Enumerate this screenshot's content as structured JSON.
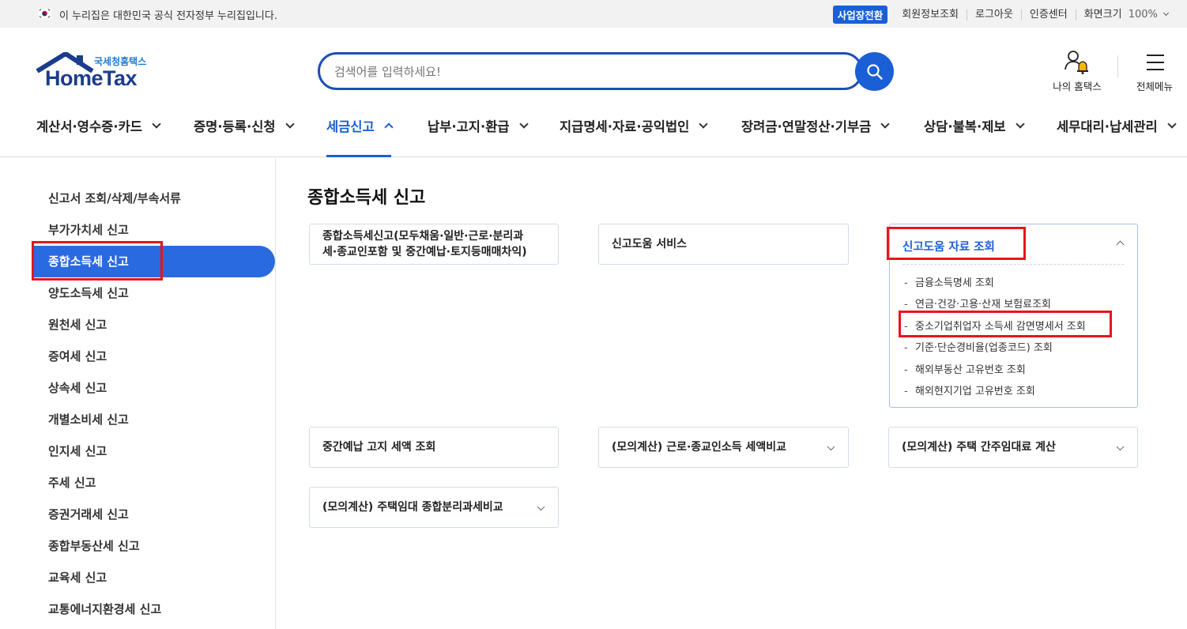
{
  "govbar": {
    "notice": "이 누리집은 대한민국 공식 전자정부 누리집입니다.",
    "biz_switch": "사업장전환",
    "links": [
      "회원정보조회",
      "로그아웃",
      "인증센터",
      "화면크기"
    ],
    "zoom": "100%"
  },
  "header": {
    "logo_sub": "국세청홈택스",
    "logo_main": "HomeTax",
    "search_placeholder": "검색어를 입력하세요!",
    "my_hometax": "나의 홈택스",
    "all_menu": "전체메뉴"
  },
  "gnb": [
    {
      "label": "계산서·영수증·카드"
    },
    {
      "label": "증명·등록·신청"
    },
    {
      "label": "세금신고"
    },
    {
      "label": "납부·고지·환급"
    },
    {
      "label": "지급명세·자료·공익법인"
    },
    {
      "label": "장려금·연말정산·기부금"
    },
    {
      "label": "상담·불복·제보"
    },
    {
      "label": "세무대리·납세관리"
    }
  ],
  "sidebar": {
    "items": [
      "신고서 조회/삭제/부속서류",
      "부가가치세 신고",
      "종합소득세 신고",
      "양도소득세 신고",
      "원천세 신고",
      "증여세 신고",
      "상속세 신고",
      "개별소비세 신고",
      "인지세 신고",
      "주세 신고",
      "증권거래세 신고",
      "종합부동산세 신고",
      "교육세 신고",
      "교통에너지환경세 신고"
    ]
  },
  "main": {
    "title": "종합소득세 신고",
    "cards": {
      "card1_line1": "종합소득세신고(모두채움·일반·근로·분리과",
      "card1_line2": "세·종교인포함 및 중간예납·토지등매매차익)",
      "card2": "신고도움 서비스",
      "card3": "신고도움 자료 조회",
      "card4": "중간예납 고지 세액 조회",
      "card5": "(모의계산) 근로·종교인소득 세액비교",
      "card6": "(모의계산) 주택 간주임대료 계산",
      "card7": "(모의계산) 주택임대 종합분리과세비교"
    },
    "sub_items": [
      "금융소득명세 조회",
      "연금·건강·고용·산재 보험료조회",
      "중소기업취업자 소득세 감면명세서 조회",
      "기준·단순경비율(업종코드) 조회",
      "해외부동산 고유번호 조회",
      "해외현지기업 고유번호 조회"
    ]
  }
}
